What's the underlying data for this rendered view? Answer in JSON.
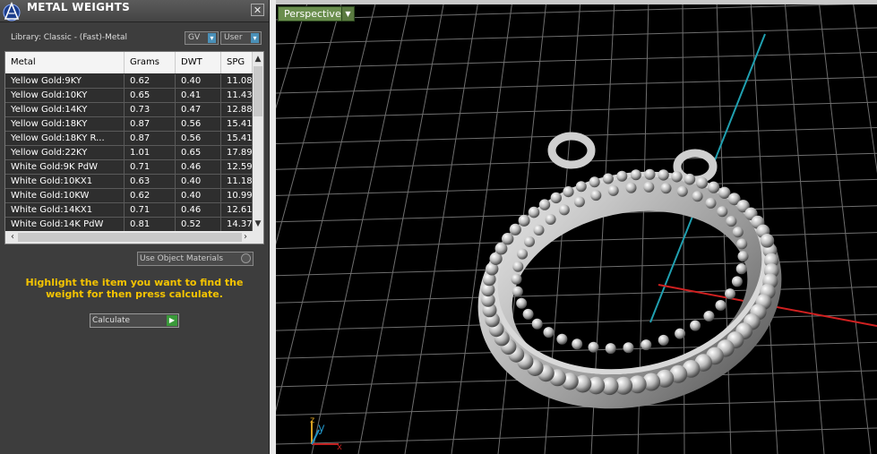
{
  "panel": {
    "title": "METAL WEIGHTS",
    "close_glyph": "✕",
    "library_label": "Library: Classic - (Fast)-Metal",
    "gv_label": "GV",
    "user_label": "User",
    "columns": [
      "Metal",
      "Grams",
      "DWT",
      "SPG"
    ],
    "rows": [
      [
        "Yellow Gold:9KY",
        "0.62",
        "0.40",
        "11.08"
      ],
      [
        "Yellow Gold:10KY",
        "0.65",
        "0.41",
        "11.43"
      ],
      [
        "Yellow Gold:14KY",
        "0.73",
        "0.47",
        "12.88"
      ],
      [
        "Yellow Gold:18KY",
        "0.87",
        "0.56",
        "15.41"
      ],
      [
        "Yellow Gold:18KY R...",
        "0.87",
        "0.56",
        "15.41"
      ],
      [
        "Yellow Gold:22KY",
        "1.01",
        "0.65",
        "17.89"
      ],
      [
        "White Gold:9K PdW",
        "0.71",
        "0.46",
        "12.59"
      ],
      [
        "White Gold:10KX1",
        "0.63",
        "0.40",
        "11.18"
      ],
      [
        "White Gold:10KW",
        "0.62",
        "0.40",
        "10.99"
      ],
      [
        "White Gold:14KX1",
        "0.71",
        "0.46",
        "12.61"
      ],
      [
        "White Gold:14K PdW",
        "0.81",
        "0.52",
        "14.37"
      ]
    ],
    "use_object_materials": "Use Object Materials",
    "hint": "Highlight the item you want to find the weight for then press calculate.",
    "calculate_label": "Calculate"
  },
  "viewport": {
    "view_label": "Perspective",
    "axis_labels": {
      "z": "z",
      "y": "y",
      "x": "x"
    }
  },
  "colors": {
    "hint": "#f5c400",
    "axis_x": "#d02020",
    "axis_y": "#20a0b0",
    "view_button": "#6a8e4e"
  }
}
